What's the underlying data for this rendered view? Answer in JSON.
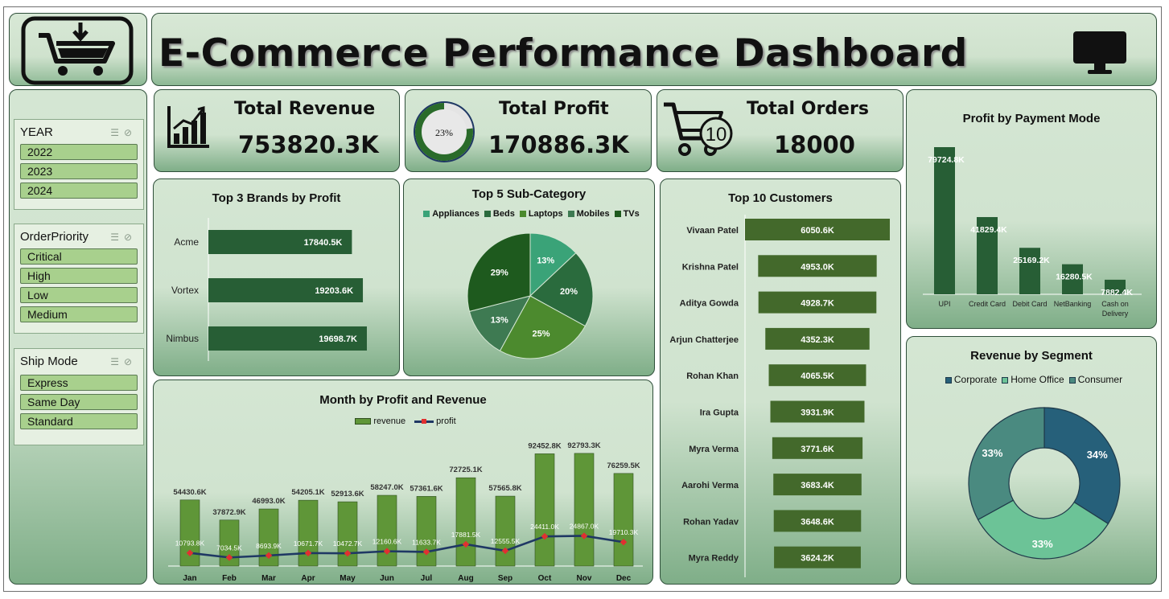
{
  "header": {
    "title": "E-Commerce Performance Dashboard",
    "cart_icon": "cart-download-icon",
    "monitor_icon": "monitor-icon"
  },
  "kpis": {
    "revenue": {
      "label": "Total Revenue",
      "value": "753820.3K",
      "icon": "bar-chart-icon"
    },
    "profit": {
      "label": "Total Profit",
      "value": "170886.3K",
      "gauge_label": "23%",
      "gauge_percent": 23
    },
    "orders": {
      "label": "Total Orders",
      "value": "18000",
      "icon": "cart-10-icon",
      "badge": "10"
    }
  },
  "slicers": {
    "year": {
      "title": "YEAR",
      "items": [
        "2022",
        "2023",
        "2024"
      ]
    },
    "priority": {
      "title": "OrderPriority",
      "items": [
        "Critical",
        "High",
        "Low",
        "Medium"
      ]
    },
    "ship": {
      "title": "Ship Mode",
      "items": [
        "Express",
        "Same Day",
        "Standard"
      ]
    }
  },
  "colors": {
    "dark_green": "#275e35",
    "olive": "#43692b",
    "bar_green": "#5f9638",
    "navy": "#1f3864",
    "marker": "#e03030"
  },
  "chart_data": [
    {
      "id": "brands",
      "type": "bar",
      "orientation": "horizontal",
      "title": "Top 3 Brands by Profit",
      "categories": [
        "Acme",
        "Vortex",
        "Nimbus"
      ],
      "values": [
        17840.5,
        19203.6,
        19698.7
      ],
      "labels": [
        "17840.5K",
        "19203.6K",
        "19698.7K"
      ]
    },
    {
      "id": "subcat",
      "type": "pie",
      "title": "Top 5 Sub-Category",
      "categories": [
        "Appliances",
        "Beds",
        "Laptops",
        "Mobiles",
        "TVs"
      ],
      "values": [
        13,
        20,
        25,
        13,
        29
      ],
      "labels": [
        "13%",
        "20%",
        "25%",
        "13%",
        "29%"
      ],
      "colors": [
        "#3aa378",
        "#2a6b3d",
        "#4c8a2e",
        "#3e7a52",
        "#1e5a1e"
      ]
    },
    {
      "id": "monthly",
      "type": "bar",
      "title": "Month by Profit and Revenue",
      "categories": [
        "Jan",
        "Feb",
        "Mar",
        "Apr",
        "May",
        "Jun",
        "Jul",
        "Aug",
        "Sep",
        "Oct",
        "Nov",
        "Dec"
      ],
      "series": [
        {
          "name": "revenue",
          "type": "bar",
          "values": [
            54430.6,
            37872.9,
            46993.0,
            54205.1,
            52913.6,
            58247.0,
            57361.6,
            72725.1,
            57565.8,
            92452.8,
            92793.3,
            76259.5
          ],
          "labels": [
            "54430.6K",
            "37872.9K",
            "46993.0K",
            "54205.1K",
            "52913.6K",
            "58247.0K",
            "57361.6K",
            "72725.1K",
            "57565.8K",
            "92452.8K",
            "92793.3K",
            "76259.5K"
          ]
        },
        {
          "name": "profit",
          "type": "line",
          "values": [
            10793.8,
            7034.5,
            8693.9,
            10671.7,
            10472.7,
            12160.6,
            11633.7,
            17881.5,
            12555.5,
            24411.0,
            24867.0,
            19710.3
          ],
          "labels": [
            "10793.8K",
            "7034.5K",
            "8693.9K",
            "10671.7K",
            "10472.7K",
            "12160.6K",
            "11633.7K",
            "17881.5K",
            "12555.5K",
            "24411.0K",
            "24867.0K",
            "19710.3K"
          ]
        }
      ],
      "ylim": [
        0,
        100000
      ]
    },
    {
      "id": "customers",
      "type": "bar",
      "orientation": "horizontal",
      "title": "Top 10 Customers",
      "categories": [
        "Vivaan Patel",
        "Krishna Patel",
        "Aditya Gowda",
        "Arjun Chatterjee",
        "Rohan Khan",
        "Ira Gupta",
        "Myra Verma",
        "Aarohi Verma",
        "Rohan Yadav",
        "Myra Reddy"
      ],
      "values": [
        6050.6,
        4953.0,
        4928.7,
        4352.3,
        4065.5,
        3931.9,
        3771.6,
        3683.4,
        3648.6,
        3624.2
      ],
      "labels": [
        "6050.6K",
        "4953.0K",
        "4928.7K",
        "4352.3K",
        "4065.5K",
        "3931.9K",
        "3771.6K",
        "3683.4K",
        "3648.6K",
        "3624.2K"
      ]
    },
    {
      "id": "payment",
      "type": "bar",
      "title": "Profit by Payment Mode",
      "categories": [
        "UPI",
        "Credit Card",
        "Debit Card",
        "NetBanking",
        "Cash on Delivery"
      ],
      "values": [
        79724.8,
        41829.4,
        25169.2,
        16280.5,
        7882.4
      ],
      "labels": [
        "79724.8K",
        "41829.4K",
        "25169.2K",
        "16280.5K",
        "7882.4K"
      ]
    },
    {
      "id": "segment",
      "type": "pie",
      "donut": true,
      "title": "Revenue  by Segment",
      "categories": [
        "Corporate",
        "Home Office",
        "Consumer"
      ],
      "values": [
        34,
        33,
        33
      ],
      "labels": [
        "34%",
        "33%",
        "33%"
      ],
      "colors": [
        "#26607a",
        "#6cc397",
        "#4a8a80"
      ]
    }
  ]
}
